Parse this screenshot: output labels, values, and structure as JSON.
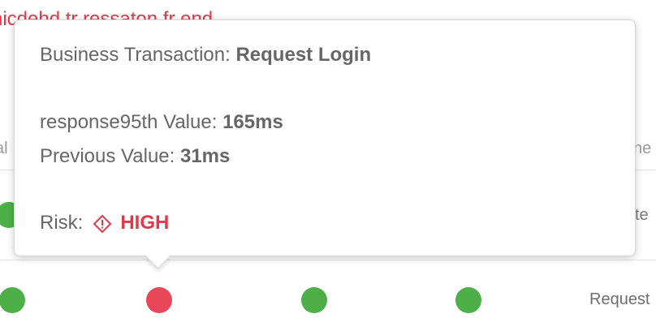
{
  "background": {
    "top_fragment": "nicdehd tr ressaton fr end",
    "left_fragment": "al",
    "right_fragment_1": "ne",
    "right_fragment_2": "te",
    "row_label": "Request"
  },
  "tooltip": {
    "business_transaction_label": "Business Transaction:",
    "business_transaction_value": "Request Login",
    "metric_label": "response95th Value:",
    "metric_value": "165ms",
    "previous_label": "Previous Value:",
    "previous_value": "31ms",
    "risk_label": "Risk:",
    "risk_icon": "warning-diamond-icon",
    "risk_value": "HIGH"
  },
  "status_dots": {
    "row1": [
      "green"
    ],
    "row2": [
      "green",
      "red",
      "green",
      "green"
    ]
  },
  "colors": {
    "risk_red": "#e03a4a",
    "dot_green": "#4caf48",
    "dot_red": "#e8475a",
    "text_gray": "#666666"
  }
}
